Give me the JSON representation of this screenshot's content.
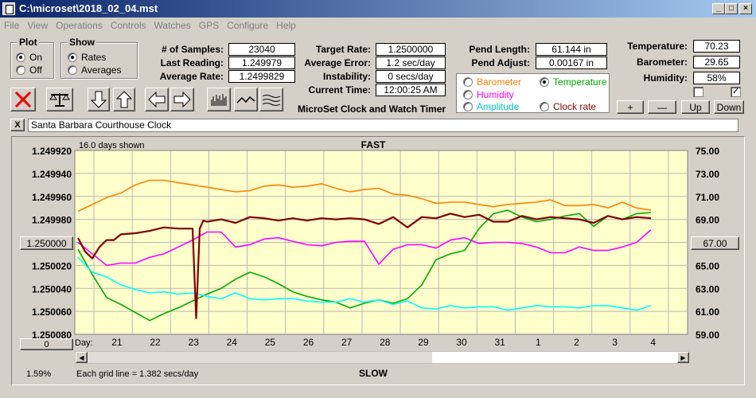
{
  "window": {
    "title": "C:\\microset\\2018_02_04.mst"
  },
  "menu": [
    "File",
    "View",
    "Operations",
    "Controls",
    "Watches",
    "GPS",
    "Configure",
    "Help"
  ],
  "plot_group": {
    "title": "Plot",
    "on": "On",
    "off": "Off",
    "selected": "On"
  },
  "show_group": {
    "title": "Show",
    "rates": "Rates",
    "averages": "Averages",
    "selected": "Rates"
  },
  "stats": {
    "samples_label": "# of Samples:",
    "samples": "23040",
    "last_reading_label": "Last Reading:",
    "last_reading": "1.249979",
    "average_rate_label": "Average Rate:",
    "average_rate": "1.2499829",
    "target_rate_label": "Target Rate:",
    "target_rate": "1.2500000",
    "average_error_label": "Average Error:",
    "average_error": "1.2 sec/day",
    "instability_label": "Instability:",
    "instability": "0 secs/day",
    "current_time_label": "Current Time:",
    "current_time": "12:00:25 AM",
    "app_name": "MicroSet Clock and Watch Timer",
    "pend_length_label": "Pend Length:",
    "pend_length": "61.144 in",
    "pend_adjust_label": "Pend Adjust:",
    "pend_adjust": "0.00167 in",
    "temperature_label": "Temperature:",
    "temperature": "70.23",
    "barometer_label": "Barometer:",
    "barometer": "29.65",
    "humidity_label": "Humidity:",
    "humidity": "58%"
  },
  "legend": {
    "barometer": "Barometer",
    "temperature": "Temperature",
    "humidity": "Humidity",
    "amplitude": "Amplitude",
    "clock_rate": "Clock rate",
    "selected": "Temperature"
  },
  "right_buttons": {
    "plus": "+",
    "minus": "—",
    "up": "Up",
    "down": "Down"
  },
  "description": "Santa Barbara Courthouse Clock",
  "close_x": "X",
  "colors": {
    "plot_bg": "#ffffcc",
    "barometer": "#ff8000",
    "temperature": "#00aa00",
    "humidity": "#ff00ff",
    "amplitude": "#00ffff",
    "clock_rate": "#800000"
  },
  "chart": {
    "days_shown": "16.0 days shown",
    "top_label": "FAST",
    "bottom_label": "SLOW",
    "center_value": "1.250000",
    "right_center_value": "67.00",
    "left_scale_button": "0",
    "percent": "1.59%",
    "grid_note": "Each grid line = 1.382 secs/day",
    "day_label": "Day:"
  },
  "chart_data": {
    "type": "line",
    "left_ticks": [
      "1.249920",
      "1.249940",
      "1.249960",
      "1.249980",
      "1.250000",
      "1.250020",
      "1.250040",
      "1.250060",
      "1.250080"
    ],
    "right_ticks": [
      "75.00",
      "73.00",
      "71.00",
      "69.00",
      "67.00",
      "65.00",
      "63.00",
      "61.00",
      "59.00"
    ],
    "x_ticks": [
      "21",
      "22",
      "23",
      "24",
      "25",
      "26",
      "27",
      "28",
      "29",
      "30",
      "31",
      "1",
      "2",
      "3",
      "4"
    ],
    "ylim_left": [
      1.25008,
      1.24992
    ],
    "ylim_right": [
      59,
      75
    ],
    "grid": true,
    "series": [
      {
        "key": "barometer",
        "color": "#ff8000",
        "x": [
          0,
          0.4,
          0.8,
          1.2,
          1.6,
          2,
          2.4,
          2.8,
          3.2,
          3.6,
          4,
          4.4,
          4.8,
          5.2,
          5.6,
          6,
          6.4,
          6.8,
          7.2,
          7.6,
          8,
          8.4,
          8.8,
          9.2,
          9.6,
          10,
          10.4,
          10.8,
          11.2,
          11.6,
          12,
          12.4,
          12.8,
          13.2,
          13.6,
          14,
          14.4,
          14.8,
          15.2,
          15.6,
          16
        ],
        "y": [
          69.7,
          70.3,
          70.9,
          71.3,
          72.0,
          72.4,
          72.4,
          72.2,
          72.0,
          71.8,
          71.6,
          71.4,
          71.5,
          71.9,
          72.0,
          71.8,
          71.9,
          72.1,
          71.7,
          71.4,
          71.6,
          71.7,
          71.2,
          71.1,
          70.8,
          70.4,
          70.5,
          70.5,
          70.3,
          70.1,
          70.3,
          70.4,
          70.5,
          70.7,
          70.2,
          70.2,
          70.3,
          70.0,
          70.5,
          70.0,
          69.8
        ]
      },
      {
        "key": "temperature",
        "color": "#00aa00",
        "x": [
          0,
          0.4,
          0.8,
          1.2,
          1.6,
          2,
          2.4,
          2.8,
          3.2,
          3.6,
          4,
          4.4,
          4.8,
          5.2,
          5.6,
          6,
          6.4,
          6.8,
          7.2,
          7.6,
          8,
          8.4,
          8.8,
          9.2,
          9.6,
          10,
          10.4,
          10.8,
          11.2,
          11.6,
          12,
          12.4,
          12.8,
          13.2,
          13.6,
          14,
          14.4,
          14.8,
          15.2,
          15.6,
          16
        ],
        "y": [
          66.4,
          64.2,
          62.2,
          61.6,
          60.9,
          60.2,
          60.8,
          61.3,
          61.9,
          62.5,
          63.0,
          63.8,
          64.4,
          64.0,
          63.4,
          62.7,
          62.3,
          62.0,
          61.8,
          61.3,
          61.7,
          62.0,
          61.7,
          62.1,
          63.3,
          65.5,
          66.0,
          66.3,
          68.2,
          69.5,
          69.8,
          69.2,
          68.8,
          69.0,
          69.3,
          69.5,
          68.4,
          69.3,
          69.0,
          69.5,
          69.6
        ]
      },
      {
        "key": "humidity",
        "color": "#ff00ff",
        "x": [
          0,
          0.4,
          0.8,
          1.2,
          1.6,
          2,
          2.4,
          2.8,
          3.2,
          3.6,
          4,
          4.4,
          4.8,
          5.2,
          5.6,
          6,
          6.4,
          6.8,
          7.2,
          7.6,
          8,
          8.4,
          8.8,
          9.2,
          9.6,
          10,
          10.4,
          10.8,
          11.2,
          11.6,
          12,
          12.4,
          12.8,
          13.2,
          13.6,
          14,
          14.4,
          14.8,
          15.2,
          15.6,
          16
        ],
        "y": [
          67.0,
          66.0,
          65.0,
          65.2,
          65.2,
          65.7,
          66.0,
          66.6,
          67.2,
          67.9,
          67.9,
          66.6,
          66.8,
          67.3,
          67.4,
          67.1,
          66.8,
          66.7,
          67.0,
          67.1,
          67.1,
          65.1,
          66.4,
          66.8,
          66.8,
          66.5,
          67.2,
          67.4,
          66.9,
          67.0,
          67.0,
          66.9,
          66.6,
          66.1,
          66.1,
          66.6,
          66.3,
          66.3,
          66.6,
          67.0,
          68.1
        ]
      },
      {
        "key": "amplitude",
        "color": "#00ffff",
        "x": [
          0,
          0.4,
          0.8,
          1.2,
          1.6,
          2,
          2.4,
          2.8,
          3.2,
          3.6,
          4,
          4.4,
          4.8,
          5.2,
          5.6,
          6,
          6.4,
          6.8,
          7.2,
          7.6,
          8,
          8.4,
          8.8,
          9.2,
          9.6,
          10,
          10.4,
          10.8,
          11.2,
          11.6,
          12,
          12.4,
          12.8,
          13.2,
          13.6,
          14,
          14.4,
          14.8,
          15.2,
          15.6,
          16
        ],
        "y": [
          65.7,
          64.4,
          64.0,
          63.3,
          62.9,
          62.6,
          62.7,
          62.5,
          62.6,
          62.3,
          62.1,
          62.6,
          62.1,
          62.0,
          62.1,
          62.1,
          61.9,
          61.8,
          61.8,
          62.1,
          61.8,
          62.0,
          61.6,
          61.9,
          61.3,
          61.2,
          61.5,
          61.3,
          61.4,
          61.4,
          61.1,
          61.3,
          61.5,
          61.4,
          61.4,
          61.3,
          61.5,
          61.5,
          61.3,
          61.1,
          61.5
        ]
      },
      {
        "key": "clock_rate",
        "color": "#800000",
        "x": [
          0,
          0.2,
          0.4,
          0.6,
          0.8,
          1.0,
          1.2,
          1.6,
          2.0,
          2.4,
          2.8,
          3.2,
          3.3,
          3.4,
          3.5,
          3.6,
          4.0,
          4.4,
          4.8,
          5.2,
          5.6,
          6.0,
          6.4,
          6.8,
          7.2,
          7.6,
          8.0,
          8.4,
          8.8,
          9.2,
          9.6,
          10.0,
          10.4,
          10.8,
          11.2,
          11.6,
          12.0,
          12.4,
          12.8,
          13.2,
          13.6,
          14.0,
          14.4,
          14.8,
          15.2,
          15.6,
          16.0
        ],
        "y": [
          1.249996,
          1.250008,
          1.250014,
          1.250004,
          1.249998,
          1.249998,
          1.249993,
          1.249992,
          1.24999,
          1.249987,
          1.249988,
          1.249988,
          1.250066,
          1.249988,
          1.249981,
          1.249982,
          1.24998,
          1.249983,
          1.249978,
          1.249979,
          1.249981,
          1.249979,
          1.249981,
          1.249979,
          1.24998,
          1.249979,
          1.24998,
          1.249984,
          1.249978,
          1.249987,
          1.249978,
          1.249979,
          1.249975,
          1.249978,
          1.249976,
          1.249982,
          1.249982,
          1.249977,
          1.24998,
          1.249978,
          1.249979,
          1.24998,
          1.249983,
          1.249977,
          1.24998,
          1.249978,
          1.249979
        ]
      }
    ]
  }
}
